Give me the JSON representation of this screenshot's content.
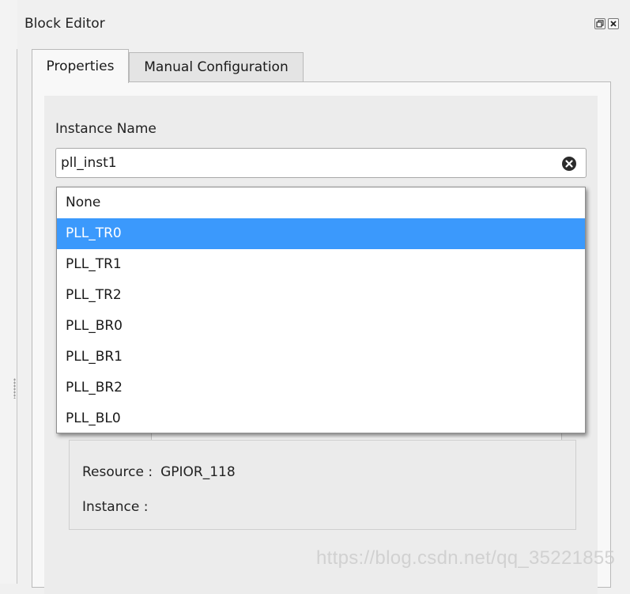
{
  "panel": {
    "title": "Block Editor"
  },
  "tabs": [
    {
      "label": "Properties",
      "active": true
    },
    {
      "label": "Manual Configuration",
      "active": false
    }
  ],
  "form": {
    "instance_name_label": "Instance Name",
    "instance_name_value": "pll_inst1"
  },
  "dropdown": {
    "options": [
      "None",
      "PLL_TR0",
      "PLL_TR1",
      "PLL_TR2",
      "PLL_BR0",
      "PLL_BR1",
      "PLL_BR2",
      "PLL_BL0"
    ],
    "selected": "PLL_TR0"
  },
  "resource_group": {
    "resource_label": "Resource :",
    "resource_value": "GPIOR_118",
    "instance_label": "Instance :",
    "instance_value": ""
  },
  "watermark": "https://blog.csdn.net/qq_35221855",
  "colors": {
    "selection": "#3b99fc",
    "panel_bg": "#f0f0f0"
  },
  "icons": [
    "restore-icon",
    "close-icon",
    "clear-icon"
  ]
}
